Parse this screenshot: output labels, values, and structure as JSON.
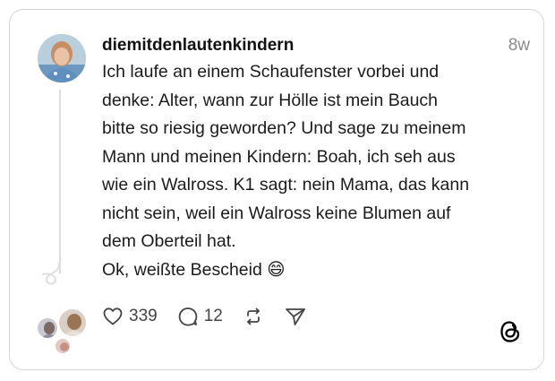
{
  "post": {
    "username": "diemitdenlautenkindern",
    "timestamp": "8w",
    "lines": [
      "Ich laufe an einem Schaufenster vorbei und",
      "denke: Alter, wann zur Hölle ist mein Bauch",
      "bitte so riesig geworden? Und sage zu meinem",
      "Mann und meinen Kindern: Boah, ich seh aus",
      "wie ein Walross. K1 sagt: nein Mama, das kann",
      "nicht sein, weil ein Walross keine Blumen auf",
      "dem Oberteil hat.",
      "Ok, weißte Bescheid 😄"
    ]
  },
  "actions": {
    "likes": "339",
    "replies": "12",
    "icons": [
      "heart-icon",
      "comment-icon",
      "repost-icon",
      "share-icon"
    ]
  },
  "branding": {
    "logo_icon": "threads-logo-icon"
  },
  "colors": {
    "border": "#d7d7d7",
    "muted": "#8b8b8b",
    "thread_line": "#dedede"
  }
}
